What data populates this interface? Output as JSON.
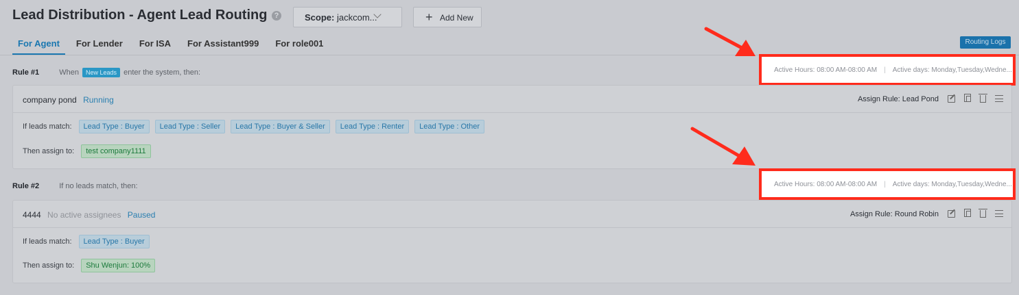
{
  "header": {
    "title": "Lead Distribution - Agent Lead Routing",
    "help_icon": "question-circle-icon",
    "scope_label": "Scope:",
    "scope_value": "jackcom...",
    "add_new_label": "Add New"
  },
  "tabs": [
    {
      "label": "For Agent",
      "active": true
    },
    {
      "label": "For Lender",
      "active": false
    },
    {
      "label": "For ISA",
      "active": false
    },
    {
      "label": "For Assistant999",
      "active": false
    },
    {
      "label": "For role001",
      "active": false
    }
  ],
  "routing_logs_label": "Routing Logs",
  "rules": [
    {
      "number": "Rule #1",
      "when_prefix": "When",
      "badge": "New Leads",
      "when_suffix": "enter the system, then:",
      "active_hours": "Active Hours: 08:00 AM-08:00 AM",
      "active_separator": "|",
      "active_days": "Active days: Monday,Tuesday,Wedne...",
      "card": {
        "name": "company pond",
        "note": "",
        "status": "Running",
        "assign_rule": "Assign Rule: Lead Pond",
        "match_label": "If leads match:",
        "match_tags": [
          "Lead Type : Buyer",
          "Lead Type : Seller",
          "Lead Type : Buyer & Seller",
          "Lead Type : Renter",
          "Lead Type : Other"
        ],
        "assign_label": "Then assign to:",
        "assignees": [
          "test company1111"
        ]
      }
    },
    {
      "number": "Rule #2",
      "when_prefix": "If no leads match, then:",
      "badge": "",
      "when_suffix": "",
      "active_hours": "Active Hours: 08:00 AM-08:00 AM",
      "active_separator": "|",
      "active_days": "Active days: Monday,Tuesday,Wedne...",
      "card": {
        "name": "4444",
        "note": "No active assignees",
        "status": "Paused",
        "assign_rule": "Assign Rule: Round Robin",
        "match_label": "If leads match:",
        "match_tags": [
          "Lead Type : Buyer"
        ],
        "assign_label": "Then assign to:",
        "assignees": [
          "Shu Wenjun: 100%"
        ]
      }
    }
  ],
  "colors": {
    "accent": "#1a77b0",
    "highlight_border": "#ff2b1c",
    "arrow": "#ff2b1c"
  }
}
